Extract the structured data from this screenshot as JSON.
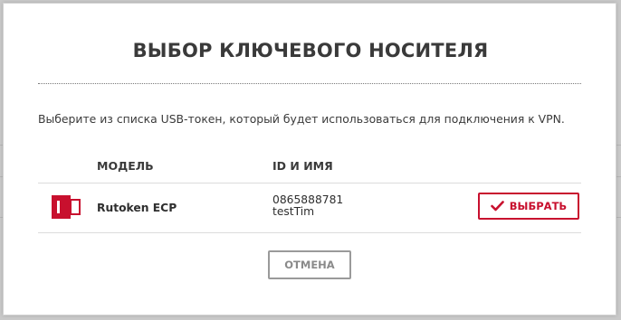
{
  "dialog": {
    "title": "ВЫБОР КЛЮЧЕВОГО НОСИТЕЛЯ",
    "description": "Выберите из списка USB-токен, который будет использоваться для подключения к VPN."
  },
  "table": {
    "columns": {
      "model": "МОДЕЛЬ",
      "id_name": "ID И ИМЯ"
    },
    "rows": [
      {
        "icon": "usb-token-icon",
        "model": "Rutoken ECP",
        "id": "0865888781",
        "name": "testTim",
        "select_label": "ВЫБРАТЬ"
      }
    ]
  },
  "cancel_label": "ОТМЕНА",
  "colors": {
    "accent": "#c8102e",
    "muted_border": "#9a9a9a",
    "text": "#333333"
  }
}
